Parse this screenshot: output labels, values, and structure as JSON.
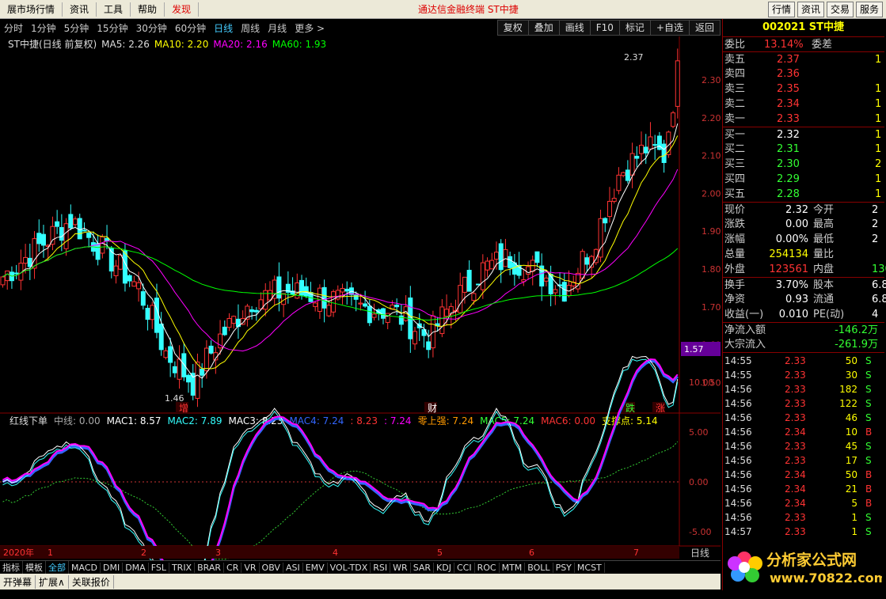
{
  "menu": {
    "items": [
      "展市场行情",
      "资讯",
      "工具",
      "帮助",
      "发现"
    ],
    "center": "通达信金融终端  ST中捷",
    "right": [
      "行情",
      "资讯",
      "交易",
      "服务"
    ]
  },
  "periods": [
    "分时",
    "1分钟",
    "5分钟",
    "15分钟",
    "30分钟",
    "60分钟",
    "日线",
    "周线",
    "月线",
    "更多 >"
  ],
  "active_period": "日线",
  "toolbar": [
    "复权",
    "叠加",
    "画线",
    "F10",
    "标记",
    "+自选",
    "返回"
  ],
  "ma_legend": {
    "name": "ST中捷(日线 前复权)",
    "ma5": "MA5: 2.26",
    "ma10": "MA10: 2.20",
    "ma20": "MA20: 2.16",
    "ma60": "MA60: 1.93"
  },
  "price_axis": [
    "2.30",
    "2.20",
    "2.10",
    "2.00",
    "1.90",
    "1.80",
    "1.70",
    "1.60",
    "1.50"
  ],
  "price_marker": "1.57",
  "high_label": "2.37",
  "low_label": "1.46",
  "event_tags": [
    "增",
    "财",
    "跌",
    "涨"
  ],
  "indicator_legend": {
    "name": "红线下单",
    "mid": "中线: 0.00",
    "mac1": "MAC1: 8.57",
    "mac2": "MAC2: 7.89",
    "mac3": "MAC3: 8.23",
    "mac4": "MAC4: 7.24",
    "v5": ": 8.23",
    "v6": ": 7.24",
    "zero": "零上强: 7.24",
    "mac5": "MAC5: 7.24",
    "mac6": "MAC6: 0.00",
    "support": "支撑点: 5.14"
  },
  "ind_axis": [
    "10.00",
    "5.00",
    "0.00",
    "-5.00"
  ],
  "date_axis": [
    "2020年",
    "1",
    "2",
    "3",
    "4",
    "5",
    "6",
    "7"
  ],
  "period_label": "日线",
  "tabs": [
    "指标",
    "模板",
    "全部",
    "MACD",
    "DMI",
    "DMA",
    "FSL",
    "TRIX",
    "BRAR",
    "CR",
    "VR",
    "OBV",
    "ASI",
    "EMV",
    "VOL-TDX",
    "RSI",
    "WR",
    "SAR",
    "KDJ",
    "CCI",
    "ROC",
    "MTM",
    "BOLL",
    "PSY",
    "MCST"
  ],
  "active_tab": "全部",
  "bottom": [
    "开弹幕",
    "扩展∧",
    "关联报价"
  ],
  "quote": {
    "code": "002021 ST中捷",
    "weibi_label": "委比",
    "weibi": "13.14%",
    "weicha": "委差",
    "asks": [
      {
        "l": "卖五",
        "p": "2.37",
        "v": "1"
      },
      {
        "l": "卖四",
        "p": "2.36",
        "v": ""
      },
      {
        "l": "卖三",
        "p": "2.35",
        "v": "1"
      },
      {
        "l": "卖二",
        "p": "2.34",
        "v": "1"
      },
      {
        "l": "卖一",
        "p": "2.33",
        "v": "1"
      }
    ],
    "bids": [
      {
        "l": "买一",
        "p": "2.32",
        "v": "1"
      },
      {
        "l": "买二",
        "p": "2.31",
        "v": "1"
      },
      {
        "l": "买三",
        "p": "2.30",
        "v": "2"
      },
      {
        "l": "买四",
        "p": "2.29",
        "v": "1"
      },
      {
        "l": "买五",
        "p": "2.28",
        "v": "1"
      }
    ],
    "stats": [
      [
        "现价",
        "2.32",
        "今开",
        "2"
      ],
      [
        "涨跌",
        "0.00",
        "最高",
        "2"
      ],
      [
        "涨幅",
        "0.00%",
        "最低",
        "2"
      ],
      [
        "总量",
        "254134",
        "量比",
        ""
      ],
      [
        "外盘",
        "123561",
        "内盘",
        "130"
      ],
      [
        "换手",
        "3.70%",
        "股本",
        "6.8"
      ],
      [
        "净资",
        "0.93",
        "流通",
        "6.8"
      ],
      [
        "收益(一)",
        "0.010",
        "PE(动)",
        "4"
      ]
    ],
    "flows": [
      [
        "净流入额",
        "-146.2万"
      ],
      [
        "大宗流入",
        "-261.9万"
      ]
    ]
  },
  "ticks": [
    [
      "14:55",
      "2.33",
      "50",
      "S"
    ],
    [
      "14:55",
      "2.33",
      "30",
      "S"
    ],
    [
      "14:56",
      "2.33",
      "182",
      "S"
    ],
    [
      "14:56",
      "2.33",
      "122",
      "S"
    ],
    [
      "14:56",
      "2.33",
      "46",
      "S"
    ],
    [
      "14:56",
      "2.34",
      "10",
      "B"
    ],
    [
      "14:56",
      "2.33",
      "45",
      "S"
    ],
    [
      "14:56",
      "2.33",
      "17",
      "S"
    ],
    [
      "14:56",
      "2.34",
      "50",
      "B"
    ],
    [
      "14:56",
      "2.34",
      "21",
      "B"
    ],
    [
      "14:56",
      "2.34",
      "5",
      "B"
    ],
    [
      "14:56",
      "2.33",
      "1",
      "S"
    ],
    [
      "14:57",
      "2.33",
      "1",
      "S"
    ]
  ],
  "logo": {
    "text": "分析家公式网",
    "url": "www.70822.com"
  }
}
